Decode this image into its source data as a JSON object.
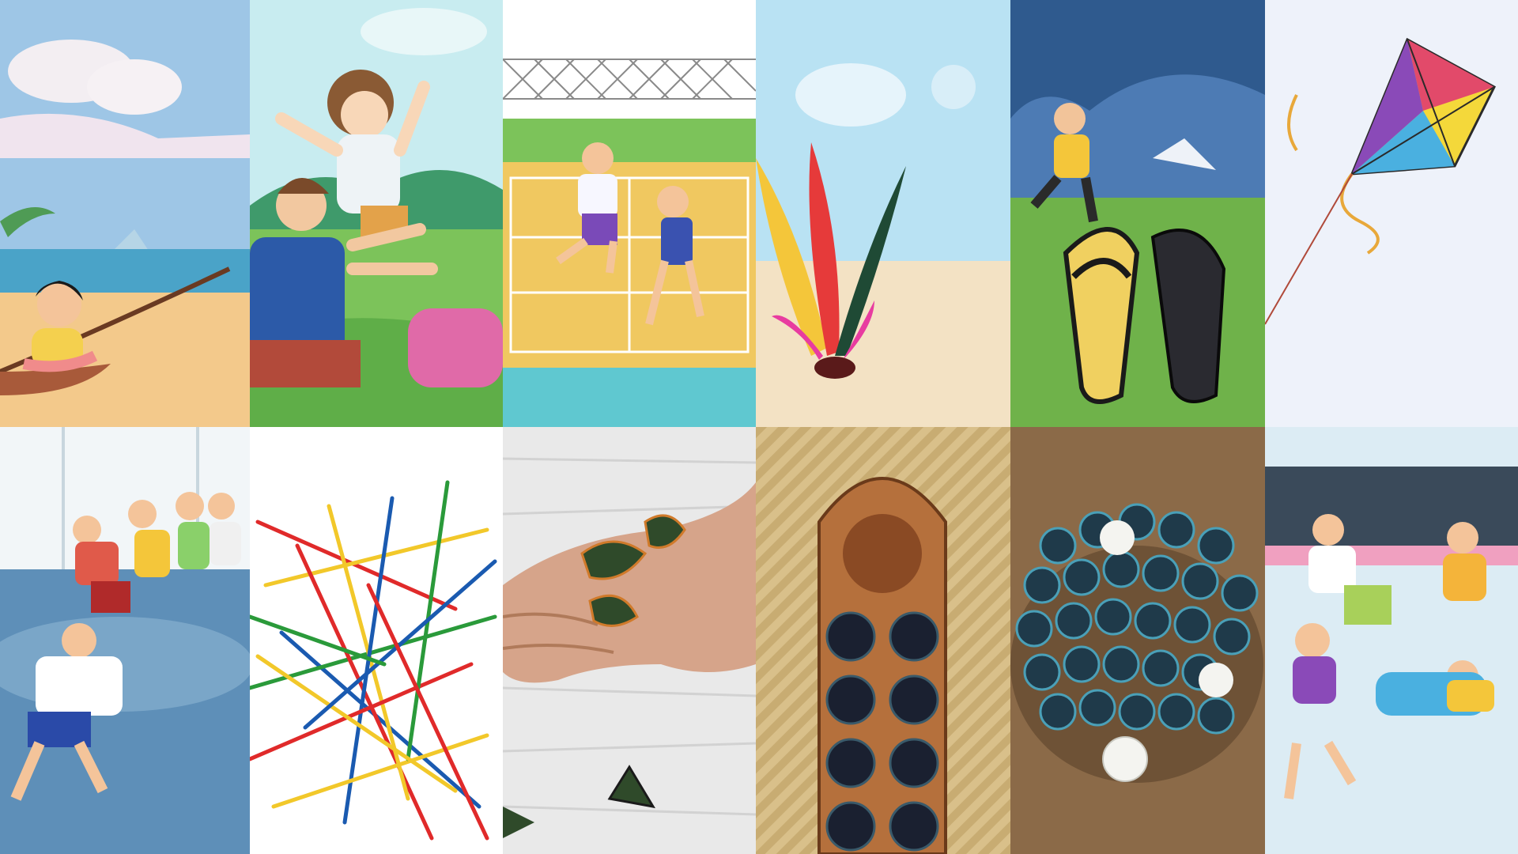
{
  "collage": {
    "columns": 6,
    "rows": 2,
    "tiles": [
      {
        "subject": "girl-on-hammock-at-beach",
        "sky_color": "#9ec6e6",
        "sand_color": "#f3c98b"
      },
      {
        "subject": "children-playing-catch-on-grass",
        "sky_color": "#c8ecf0",
        "grass_color": "#7cc35a"
      },
      {
        "subject": "boys-playing-on-court",
        "court_color": "#f0c860",
        "grass_color": "#7cc35a"
      },
      {
        "subject": "feather-shuttlecock",
        "sky_color": "#b9e2f3",
        "sand_color": "#f3e2c4"
      },
      {
        "subject": "boy-running-and-sandals",
        "water_color": "#4d7bb4",
        "grass_color": "#6fb24a"
      },
      {
        "subject": "colorful-kite",
        "sky_color": "#eef2fa"
      },
      {
        "subject": "children-running-indoors",
        "floor_color": "#5e8fb8"
      },
      {
        "subject": "pick-up-sticks",
        "background_color": "#ffffff"
      },
      {
        "subject": "hand-with-fabric-pebbles",
        "background_color": "#e9e9e9"
      },
      {
        "subject": "wooden-congklak-board",
        "mat_color": "#d9c08a",
        "board_color": "#b5703c"
      },
      {
        "subject": "pile-of-marbles",
        "ground_color": "#8b6a48"
      },
      {
        "subject": "children-playing-tag-indoors",
        "floor_color": "#dcecf4",
        "wall_color": "#3a4a5a"
      }
    ]
  }
}
